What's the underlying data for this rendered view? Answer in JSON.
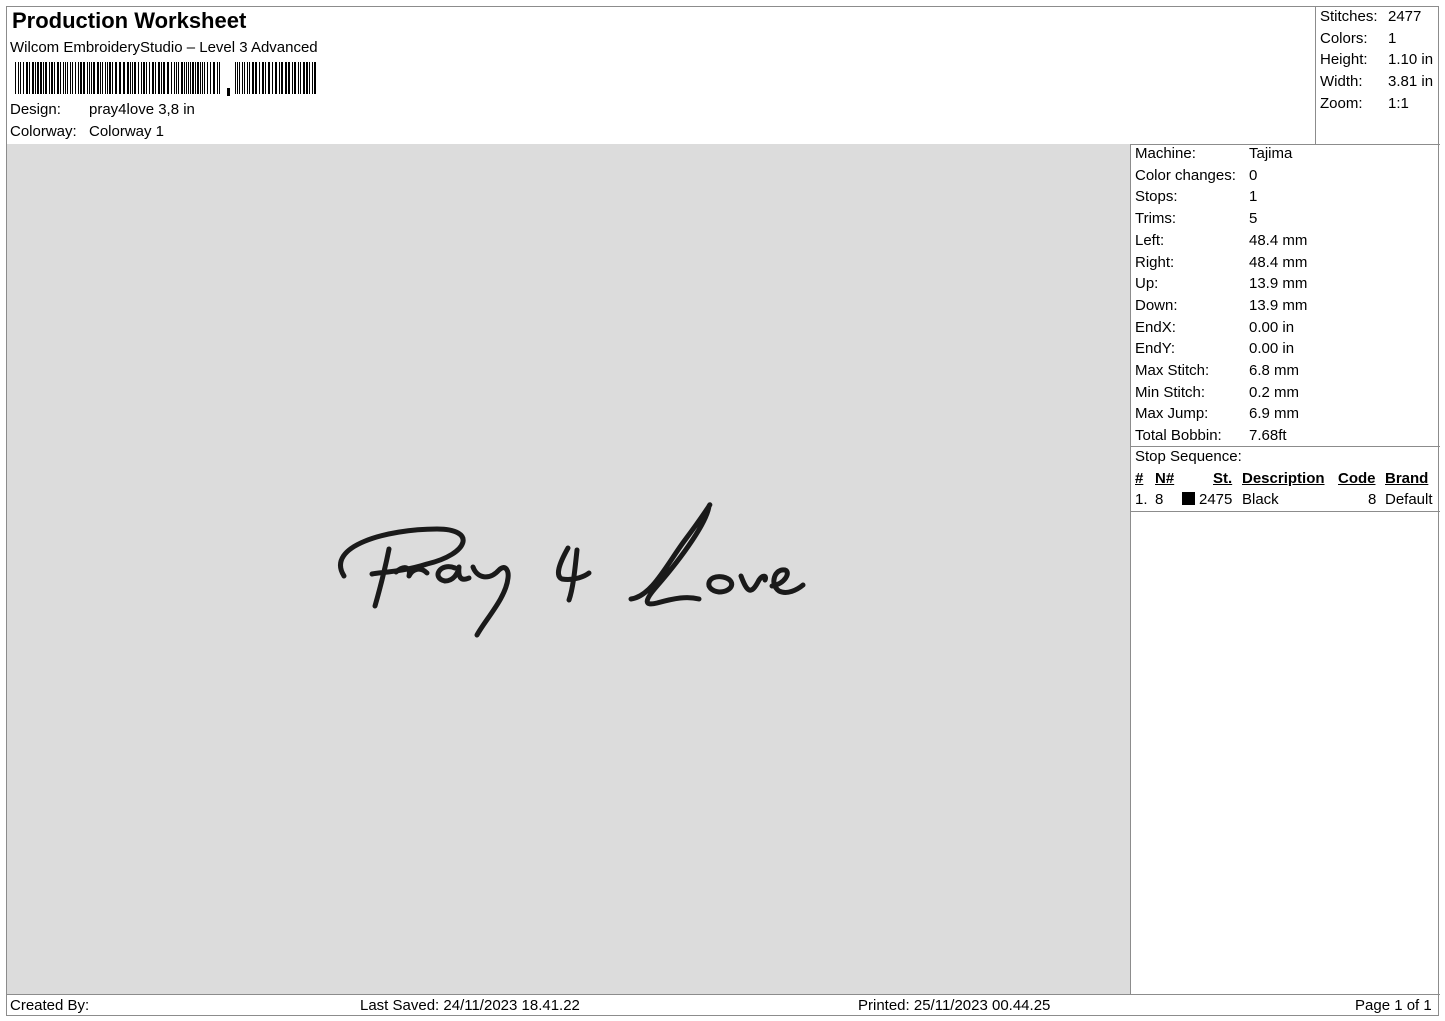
{
  "header": {
    "title": "Production Worksheet",
    "software": "Wilcom EmbroideryStudio – Level 3 Advanced",
    "design_label": "Design:",
    "design_value": "pray4love 3,8 in",
    "colorway_label": "Colorway:",
    "colorway_value": "Colorway 1"
  },
  "summary": {
    "stitches_label": "Stitches:",
    "stitches_value": "2477",
    "colors_label": "Colors:",
    "colors_value": "1",
    "height_label": "Height:",
    "height_value": "1.10 in",
    "width_label": "Width:",
    "width_value": "3.81 in",
    "zoom_label": "Zoom:",
    "zoom_value": "1:1"
  },
  "design_preview": {
    "background_color": "#dcdcdc",
    "thread_color": "#1a1a1a",
    "lettering": "Pray 4 Love"
  },
  "machine": {
    "rows": [
      {
        "label": "Machine:",
        "value": "Tajima"
      },
      {
        "label": "Color changes:",
        "value": "0"
      },
      {
        "label": "Stops:",
        "value": "1"
      },
      {
        "label": "Trims:",
        "value": "5"
      },
      {
        "label": "Left:",
        "value": "48.4 mm"
      },
      {
        "label": "Right:",
        "value": "48.4 mm"
      },
      {
        "label": "Up:",
        "value": "13.9 mm"
      },
      {
        "label": "Down:",
        "value": "13.9 mm"
      },
      {
        "label": "EndX:",
        "value": "0.00 in"
      },
      {
        "label": "EndY:",
        "value": "0.00 in"
      },
      {
        "label": "Max Stitch:",
        "value": "6.8 mm"
      },
      {
        "label": "Min Stitch:",
        "value": "0.2 mm"
      },
      {
        "label": "Max Jump:",
        "value": "6.9 mm"
      },
      {
        "label": "Total Bobbin:",
        "value": "7.68ft"
      }
    ]
  },
  "stop_sequence": {
    "caption": "Stop Sequence:",
    "columns": {
      "num": "#",
      "needle": "N#",
      "stitches": "St.",
      "description": "Description",
      "code": "Code",
      "brand": "Brand"
    },
    "rows": [
      {
        "num": "1.",
        "needle": "8",
        "swatch_color": "#000000",
        "stitches": "2475",
        "description": "Black",
        "code": "8",
        "brand": "Default"
      }
    ]
  },
  "footer": {
    "created_by": "Created By:",
    "last_saved": "Last Saved: 24/11/2023 18.41.22",
    "printed": "Printed: 25/11/2023 00.44.25",
    "page": "Page 1 of 1"
  }
}
